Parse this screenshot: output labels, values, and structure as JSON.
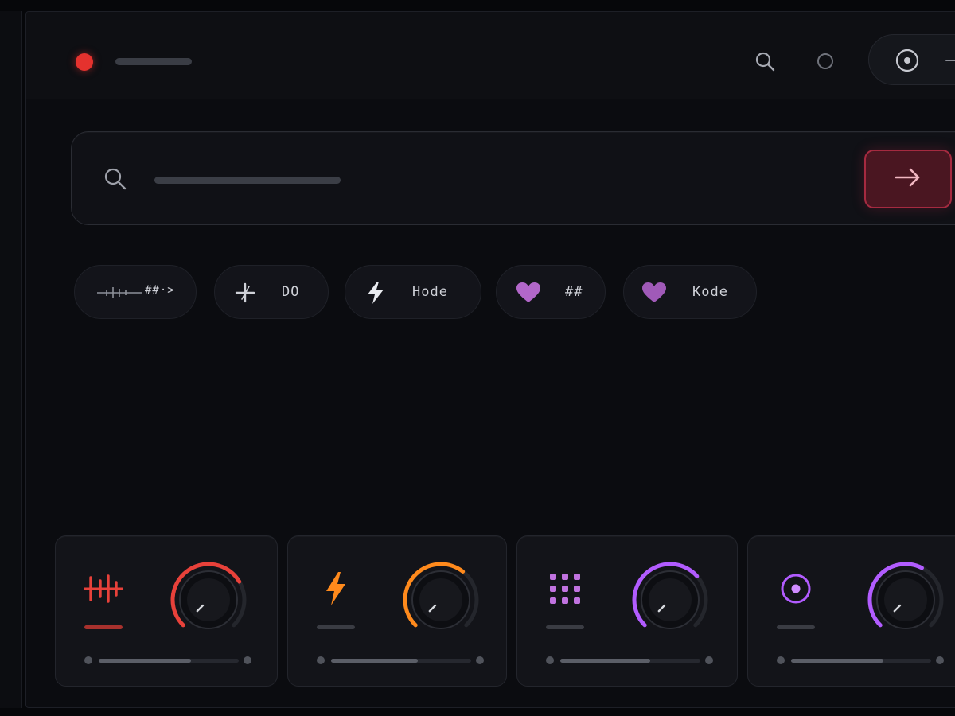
{
  "app": {
    "record_color": "#e5322e"
  },
  "toolbar": {
    "icons": [
      "search-icon",
      "dot-icon",
      "target-icon",
      "more-icon"
    ]
  },
  "search": {
    "placeholder": "",
    "icon": "search-icon",
    "submit_icon": "arrow-right-icon",
    "submit_color": "#a52a40"
  },
  "chips": [
    {
      "label": "##·>",
      "icon": "waveform-icon"
    },
    {
      "label": "DO",
      "icon": "sparkle-icon"
    },
    {
      "label": "Hode",
      "icon": "lightning-icon"
    },
    {
      "label": "##",
      "icon": "heart-icon"
    },
    {
      "label": "Kode",
      "icon": "heart-icon"
    }
  ],
  "waveform": {
    "gradient": [
      "#ff8a1c",
      "#ff5530",
      "#ff3a6a",
      "#c850e8",
      "#8a5cff"
    ]
  },
  "cards": [
    {
      "icon": "bars-icon",
      "accent": "#e8413a",
      "knob_level": 0.72,
      "slider_level": 0.66
    },
    {
      "icon": "lightning-icon",
      "accent": "#ff8a1c",
      "knob_level": 0.64,
      "slider_level": 0.62
    },
    {
      "icon": "grid-icon",
      "accent": "#b25cff",
      "knob_level": 0.68,
      "slider_level": 0.64
    },
    {
      "icon": "circle-dot-icon",
      "accent": "#b25cff",
      "knob_level": 0.6,
      "slider_level": 0.66
    }
  ]
}
